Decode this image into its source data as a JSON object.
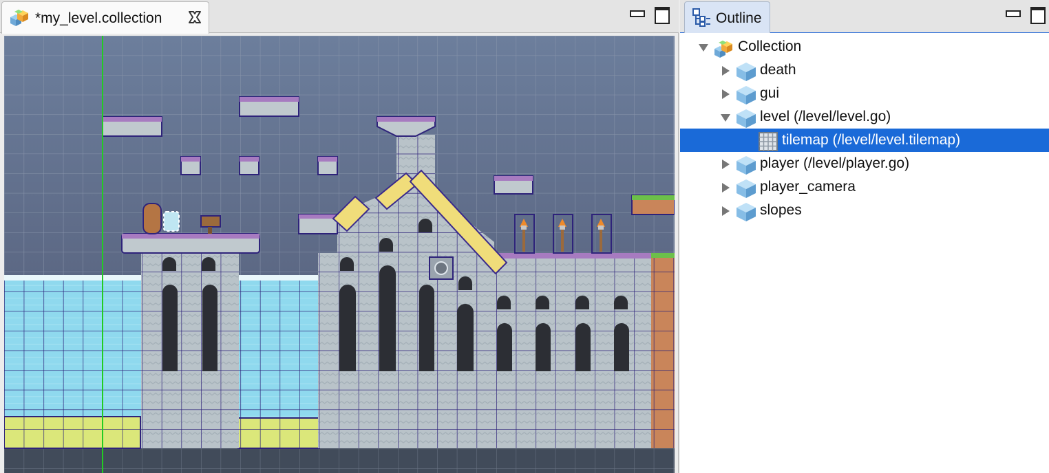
{
  "editor": {
    "tab_title": "*my_level.collection",
    "tab_icon": "collection-icon",
    "close_icon": "close-icon"
  },
  "outline": {
    "tab_title": "Outline",
    "tab_icon": "outline-icon",
    "items": [
      {
        "label": "Collection",
        "icon": "collection-icon",
        "expanded": true
      },
      {
        "label": "death",
        "icon": "game-object-icon",
        "expanded": false
      },
      {
        "label": "gui",
        "icon": "game-object-icon",
        "expanded": false
      },
      {
        "label": "level (/level/level.go)",
        "icon": "game-object-icon",
        "expanded": true
      },
      {
        "label": "tilemap (/level/level.tilemap)",
        "icon": "tilemap-icon",
        "selected": true
      },
      {
        "label": "player (/level/player.go)",
        "icon": "game-object-icon",
        "expanded": false
      },
      {
        "label": "player_camera",
        "icon": "game-object-icon",
        "expanded": false
      },
      {
        "label": "slopes",
        "icon": "game-object-icon",
        "expanded": false
      }
    ]
  },
  "colors": {
    "selection": "#1a6ad8",
    "sky_top": "#6d7f9c",
    "stone": "#b9c3c9",
    "water": "#8fd9ee",
    "grid": "#3b2a8c",
    "origin_axis": "#22cc22"
  }
}
